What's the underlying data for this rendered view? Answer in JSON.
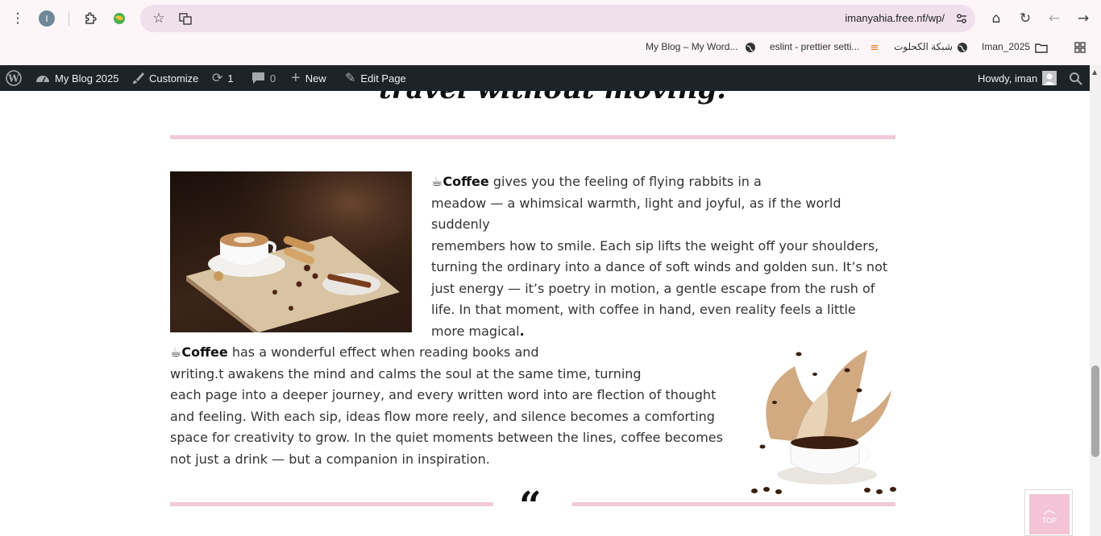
{
  "browser": {
    "url": "imanyahia.free.nf/wp/",
    "profile_initial": "I",
    "bookmarks": [
      {
        "label": "My Blog – My Word..."
      },
      {
        "label": "eslint - prettier setti..."
      },
      {
        "label": "شبكة الكحلوت"
      },
      {
        "label": "Iman_2025"
      }
    ]
  },
  "adminbar": {
    "site_name": "My Blog 2025",
    "customize": "Customize",
    "updates_count": "1",
    "comments_count": "0",
    "new_label": "New",
    "edit_label": "Edit Page",
    "howdy": "Howdy, iman"
  },
  "page": {
    "heading_cut": "travel without moving.",
    "para1": {
      "emoji": "☕",
      "bold": "Coffee",
      "lines": [
        " gives you the feeling of flying rabbits in a",
        "meadow — a whimsical warmth, light and joyful, as if the world",
        "suddenly",
        "remembers how to smile. Each sip lifts the weight off your shoulders,",
        "turning the ordinary into a dance of soft winds and golden sun. It’s not",
        "just energy — it’s poetry in motion, a gentle escape from the rush of",
        "life. In that moment, with coffee in hand, even reality feels a little",
        "more magical"
      ],
      "end": "."
    },
    "para2": {
      "emoji": "☕",
      "bold": "Coffee",
      "lines": [
        " has a wonderful effect when reading books and",
        "writing.t awakens the mind and calms the soul at the same time, turning",
        "each page into a deeper journey, and every written word into are flection of thought",
        "and feeling. With each sip, ideas flow more  reely, and silence becomes a comforting",
        "space for creativity to grow. In the quiet moments between the lines, coffee becomes",
        "not just a drink — but a companion in inspiration."
      ]
    },
    "quote_mark": "“",
    "top_label": "TOP"
  },
  "colors": {
    "accent_pink": "#f0c9da",
    "adminbar_bg": "#1d2327"
  }
}
